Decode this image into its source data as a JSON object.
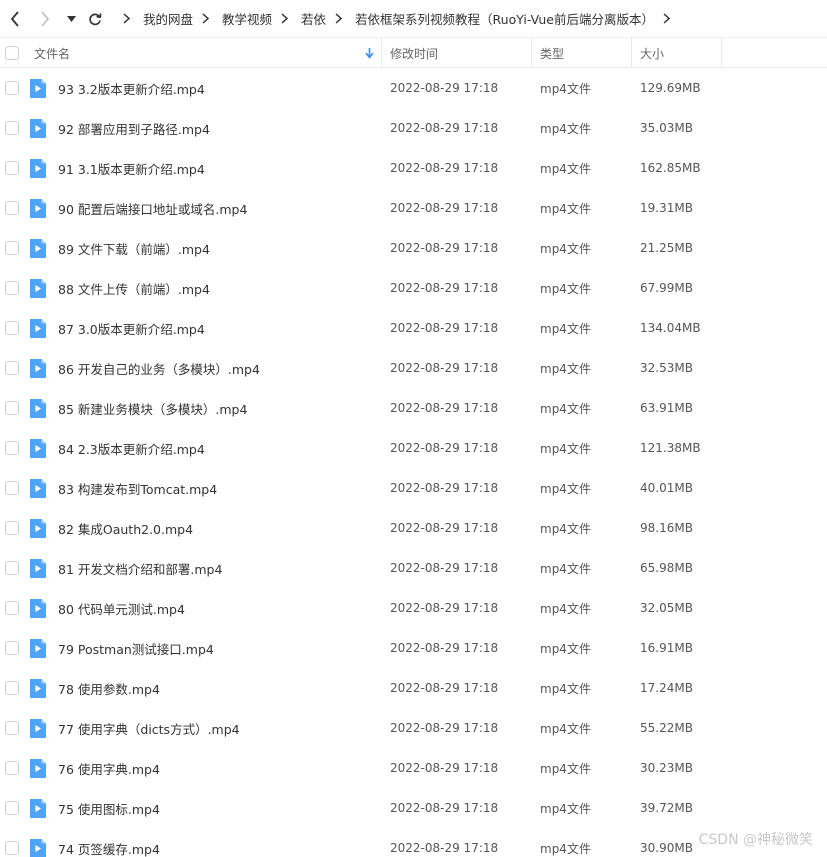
{
  "toolbar": {
    "breadcrumbs": [
      "我的网盘",
      "教学视频",
      "若依",
      "若依框架系列视频教程（RuoYi-Vue前后端分离版本）"
    ]
  },
  "columns": {
    "name": "文件名",
    "modified": "修改时间",
    "type": "类型",
    "size": "大小"
  },
  "files": [
    {
      "name": "93 3.2版本更新介绍.mp4",
      "modified": "2022-08-29 17:18",
      "type": "mp4文件",
      "size": "129.69MB"
    },
    {
      "name": "92 部署应用到子路径.mp4",
      "modified": "2022-08-29 17:18",
      "type": "mp4文件",
      "size": "35.03MB"
    },
    {
      "name": "91 3.1版本更新介绍.mp4",
      "modified": "2022-08-29 17:18",
      "type": "mp4文件",
      "size": "162.85MB"
    },
    {
      "name": "90 配置后端接口地址或域名.mp4",
      "modified": "2022-08-29 17:18",
      "type": "mp4文件",
      "size": "19.31MB"
    },
    {
      "name": "89 文件下载（前端）.mp4",
      "modified": "2022-08-29 17:18",
      "type": "mp4文件",
      "size": "21.25MB"
    },
    {
      "name": "88 文件上传（前端）.mp4",
      "modified": "2022-08-29 17:18",
      "type": "mp4文件",
      "size": "67.99MB"
    },
    {
      "name": "87 3.0版本更新介绍.mp4",
      "modified": "2022-08-29 17:18",
      "type": "mp4文件",
      "size": "134.04MB"
    },
    {
      "name": "86 开发自己的业务（多模块）.mp4",
      "modified": "2022-08-29 17:18",
      "type": "mp4文件",
      "size": "32.53MB"
    },
    {
      "name": "85 新建业务模块（多模块）.mp4",
      "modified": "2022-08-29 17:18",
      "type": "mp4文件",
      "size": "63.91MB"
    },
    {
      "name": "84 2.3版本更新介绍.mp4",
      "modified": "2022-08-29 17:18",
      "type": "mp4文件",
      "size": "121.38MB"
    },
    {
      "name": "83 构建发布到Tomcat.mp4",
      "modified": "2022-08-29 17:18",
      "type": "mp4文件",
      "size": "40.01MB"
    },
    {
      "name": "82 集成Oauth2.0.mp4",
      "modified": "2022-08-29 17:18",
      "type": "mp4文件",
      "size": "98.16MB"
    },
    {
      "name": "81 开发文档介绍和部署.mp4",
      "modified": "2022-08-29 17:18",
      "type": "mp4文件",
      "size": "65.98MB"
    },
    {
      "name": "80 代码单元测试.mp4",
      "modified": "2022-08-29 17:18",
      "type": "mp4文件",
      "size": "32.05MB"
    },
    {
      "name": "79 Postman测试接口.mp4",
      "modified": "2022-08-29 17:18",
      "type": "mp4文件",
      "size": "16.91MB"
    },
    {
      "name": "78 使用参数.mp4",
      "modified": "2022-08-29 17:18",
      "type": "mp4文件",
      "size": "17.24MB"
    },
    {
      "name": "77 使用字典（dicts方式）.mp4",
      "modified": "2022-08-29 17:18",
      "type": "mp4文件",
      "size": "55.22MB"
    },
    {
      "name": "76 使用字典.mp4",
      "modified": "2022-08-29 17:18",
      "type": "mp4文件",
      "size": "30.23MB"
    },
    {
      "name": "75 使用图标.mp4",
      "modified": "2022-08-29 17:18",
      "type": "mp4文件",
      "size": "39.72MB"
    },
    {
      "name": "74 页签缓存.mp4",
      "modified": "2022-08-29 17:18",
      "type": "mp4文件",
      "size": "30.90MB"
    }
  ],
  "watermark": "CSDN @神秘微笑",
  "colors": {
    "accent": "#3c8cf0",
    "file_icon": "#4ea5f5"
  }
}
